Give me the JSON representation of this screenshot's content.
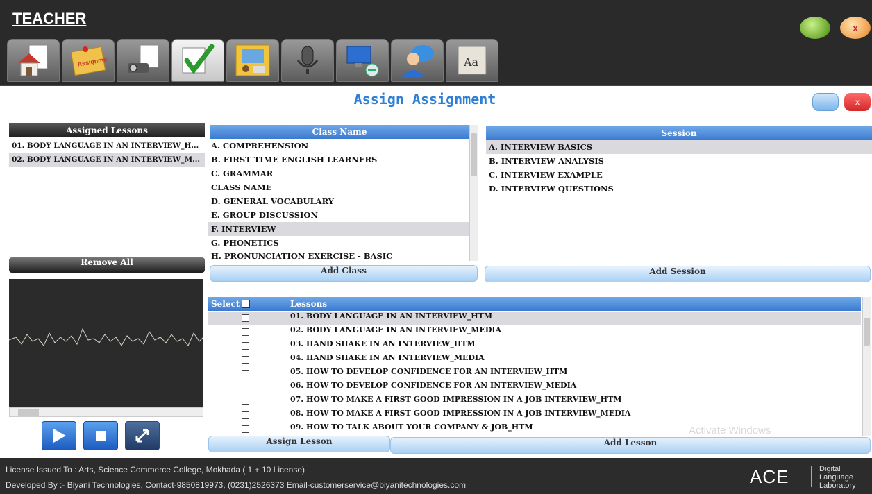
{
  "app": {
    "title": "TEACHER",
    "minimize_label": "",
    "close_label": "x"
  },
  "toolbar": {
    "items": [
      {
        "name": "home-icon"
      },
      {
        "name": "assignment-icon",
        "label": "Assignment"
      },
      {
        "name": "projector-icon"
      },
      {
        "name": "checkmark-icon"
      },
      {
        "name": "presentation-icon"
      },
      {
        "name": "microphone-icon"
      },
      {
        "name": "network-icon"
      },
      {
        "name": "chat-icon"
      },
      {
        "name": "dictionary-icon",
        "label": "Aa"
      }
    ]
  },
  "page": {
    "title": "Assign Assignment",
    "close_label": "x"
  },
  "assigned_lessons": {
    "header": "Assigned Lessons",
    "items": [
      "01. BODY LANGUAGE IN AN INTERVIEW_H...",
      "02. BODY LANGUAGE IN AN INTERVIEW_M..."
    ],
    "remove_all_label": "Remove All"
  },
  "class_panel": {
    "header": "Class Name",
    "items": [
      "A. COMPREHENSION",
      "B. FIRST TIME ENGLISH LEARNERS",
      "C. GRAMMAR",
      "CLASS NAME",
      "D. GENERAL VOCABULARY",
      "E. GROUP DISCUSSION",
      "F. INTERVIEW",
      "G. PHONETICS",
      "H. PRONUNCIATION EXERCISE - BASIC"
    ],
    "selected_index": 6,
    "add_label": "Add Class"
  },
  "session_panel": {
    "header": "Session",
    "items": [
      "A. INTERVIEW BASICS",
      "B. INTERVIEW ANALYSIS",
      "C. INTERVIEW EXAMPLE",
      "D. INTERVIEW QUESTIONS"
    ],
    "selected_index": 0,
    "add_label": "Add Session"
  },
  "lessons": {
    "select_header": "Select",
    "lessons_header": "Lessons",
    "items": [
      "01. BODY LANGUAGE IN AN INTERVIEW_HTM",
      "02. BODY LANGUAGE IN AN INTERVIEW_MEDIA",
      "03. HAND SHAKE IN AN INTERVIEW_HTM",
      "04. HAND SHAKE IN AN INTERVIEW_MEDIA",
      "05. HOW TO DEVELOP CONFIDENCE FOR AN INTERVIEW_HTM",
      "06. HOW TO DEVELOP CONFIDENCE FOR AN INTERVIEW_MEDIA",
      "07. HOW TO MAKE A FIRST GOOD IMPRESSION IN A JOB INTERVIEW_HTM",
      "08. HOW TO MAKE A FIRST GOOD IMPRESSION IN A JOB INTERVIEW_MEDIA",
      "09. HOW TO TALK ABOUT YOUR COMPANY & JOB_HTM"
    ],
    "selected_index": 0,
    "assign_label": "Assign Lesson",
    "add_label": "Add Lesson"
  },
  "media_controls": [
    "play-icon",
    "stop-icon",
    "fullscreen-icon"
  ],
  "watermark": "Activate Windows",
  "footer": {
    "license": "License Issued To :   Arts, Science  Commerce College, Mokhada ( 1 + 10 License)",
    "developer": "Developed By :- Biyani Technologies, Contact-9850819973, (0231)2526373  Email-customerservice@biyanitechnologies.com",
    "brand": "ACE",
    "brand_tag": [
      "Digital",
      "Language",
      "Laboratory"
    ]
  },
  "colors": {
    "accent": "#3b7ad0",
    "title": "#2f7fd4",
    "dark": "#2a2a2a",
    "selection": "#d9d9de"
  }
}
